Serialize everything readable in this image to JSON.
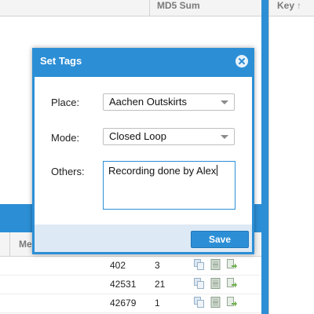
{
  "grid_top": {
    "columns": [
      "MD5 Sum"
    ]
  },
  "side_panel": {
    "header": "Key",
    "sort_icon": "up-arrow-icon"
  },
  "grid_bottom": {
    "columns": [
      "Me"
    ],
    "rows": [
      {
        "c1": "402",
        "c2": "3"
      },
      {
        "c1": "42531",
        "c2": "21"
      },
      {
        "c1": "42679",
        "c2": "1"
      }
    ],
    "row_action_icons": [
      "copy-icon",
      "film-icon",
      "export-icon"
    ]
  },
  "modal": {
    "title": "Set Tags",
    "fields": {
      "place": {
        "label": "Place:",
        "value": "Aachen Outskirts"
      },
      "mode": {
        "label": "Mode:",
        "value": "Closed Loop"
      },
      "others": {
        "label": "Others:",
        "value": "Recording done by Alex"
      }
    },
    "save_label": "Save"
  },
  "colors": {
    "accent": "#2c8fd6",
    "footer": "#dde9f4"
  }
}
